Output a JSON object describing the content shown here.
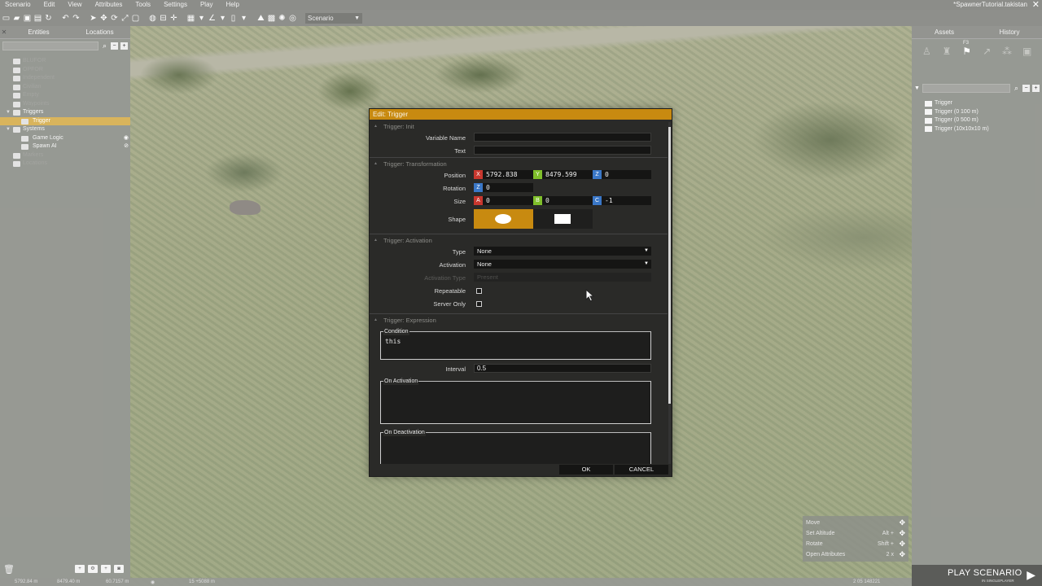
{
  "menu": [
    "Scenario",
    "Edit",
    "View",
    "Attributes",
    "Tools",
    "Settings",
    "Play",
    "Help"
  ],
  "file_title": "*SpawnerTutorial.takistan",
  "toolbar": {
    "mode_label": "Scenario"
  },
  "left_panel": {
    "tabs": [
      "Entities",
      "Locations"
    ],
    "tree": [
      {
        "label": "BLUFOR",
        "type": "faded"
      },
      {
        "label": "OPFOR",
        "type": "faded"
      },
      {
        "label": "Independent",
        "type": "faded"
      },
      {
        "label": "Civilian",
        "type": "faded"
      },
      {
        "label": "Empty",
        "type": "faded"
      },
      {
        "label": "Waypoints",
        "type": "faded"
      },
      {
        "label": "Triggers",
        "type": "bright"
      },
      {
        "label": "Trigger",
        "type": "selected"
      },
      {
        "label": "Systems",
        "type": "bright"
      },
      {
        "label": "Game Logic",
        "type": "child"
      },
      {
        "label": "Spawn AI",
        "type": "child"
      },
      {
        "label": "Markers",
        "type": "faded"
      },
      {
        "label": "Locations",
        "type": "faded"
      }
    ]
  },
  "right_panel": {
    "tabs": [
      "Assets",
      "History"
    ],
    "f3_label": "F3",
    "assets": [
      "Trigger",
      "Trigger (0 100 m)",
      "Trigger (0 500 m)",
      "Trigger (10x10x10 m)"
    ],
    "shortcuts": [
      {
        "label": "Move",
        "key": ""
      },
      {
        "label": "Set Altitude",
        "key": "Alt +"
      },
      {
        "label": "Rotate",
        "key": "Shift +"
      },
      {
        "label": "Open Attributes",
        "key": "2 x"
      }
    ],
    "play_label": "PLAY SCENARIO",
    "play_sub": "IN SINGLEPLAYER"
  },
  "status": {
    "x": "5792.84 m",
    "y": "8479.40 m",
    "z": "60.7157 m",
    "grid": "15 +5088 m",
    "time": "2 05 148221"
  },
  "dialog": {
    "title": "Edit: Trigger",
    "sections": {
      "init": "Trigger: Init",
      "transformation": "Trigger: Transformation",
      "activation": "Trigger: Activation",
      "expression": "Trigger: Expression"
    },
    "labels": {
      "variable_name": "Variable Name",
      "text": "Text",
      "position": "Position",
      "rotation": "Rotation",
      "size": "Size",
      "shape": "Shape",
      "type": "Type",
      "activation": "Activation",
      "activation_type": "Activation Type",
      "repeatable": "Repeatable",
      "server_only": "Server Only",
      "condition": "Condition",
      "interval": "Interval",
      "on_activation": "On Activation",
      "on_deactivation": "On Deactivation"
    },
    "values": {
      "variable_name": "",
      "text": "",
      "pos_x": "5792.838",
      "pos_y": "8479.599",
      "pos_z": "0",
      "rot_z": "0",
      "size_a": "0",
      "size_b": "0",
      "size_c": "-1",
      "type": "None",
      "activation": "None",
      "activation_type": "Present",
      "repeatable": false,
      "server_only": false,
      "condition": "this",
      "interval": "0.5",
      "on_activation": "",
      "on_deactivation": ""
    },
    "axis_labels": {
      "x": "X",
      "y": "Y",
      "z": "Z",
      "a": "A",
      "b": "B",
      "c": "C"
    },
    "ok_label": "OK",
    "cancel_label": "CANCEL"
  },
  "colors": {
    "accent": "#c88a10",
    "axis_x": "#c8372e",
    "axis_y": "#7fbf2a",
    "axis_z": "#3a77c7"
  }
}
